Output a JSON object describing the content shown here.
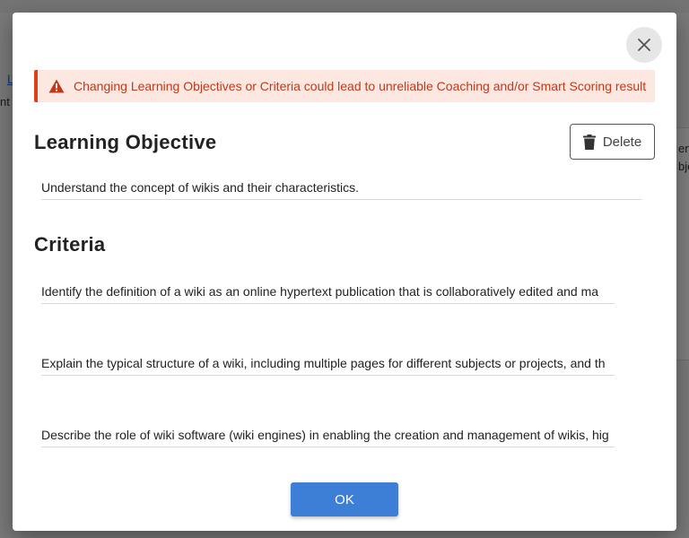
{
  "background": {
    "link_fragment": "L",
    "left_fragment": "nt",
    "right_fragment_1": "ent",
    "right_fragment_2": "bje"
  },
  "modal": {
    "close_icon": "close-icon",
    "alert": {
      "icon": "warning-icon",
      "text": "Changing Learning Objectives or Criteria could lead to unreliable Coaching and/or Smart Scoring result",
      "color": "#c0391b",
      "background": "#fde7e1"
    },
    "learning_objective": {
      "title": "Learning Objective",
      "delete_label": "Delete",
      "delete_icon": "trash-icon",
      "value": "Understand the concept of wikis and their characteristics."
    },
    "criteria": {
      "title": "Criteria",
      "items": [
        "Identify the definition of a wiki as an online hypertext publication that is collaboratively edited and ma",
        "Explain the typical structure of a wiki, including multiple pages for different subjects or projects, and th",
        "Describe the role of wiki software (wiki engines) in enabling the creation and management of wikis, hig"
      ]
    },
    "ok_label": "OK",
    "accent": "#3d7fd6"
  }
}
